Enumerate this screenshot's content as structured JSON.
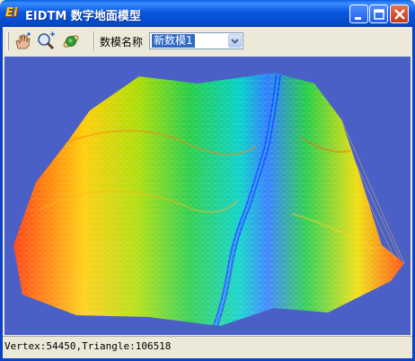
{
  "window": {
    "app_icon_text": "Ei",
    "title": "EIDTM 数字地面模型",
    "controls": [
      "minimize-icon",
      "maximize-icon",
      "close-icon"
    ]
  },
  "toolbar": {
    "tools": [
      "pan-hand-icon",
      "zoom-icon",
      "rotate-globe-icon"
    ],
    "model_label": "数模名称",
    "model_select": {
      "value": "新数模1"
    }
  },
  "viewport": {
    "content": "3D terrain TIN wireframe render",
    "background_color": "#4b60c6"
  },
  "statusbar": {
    "text": "Vertex:54450,Triangle:106518"
  }
}
